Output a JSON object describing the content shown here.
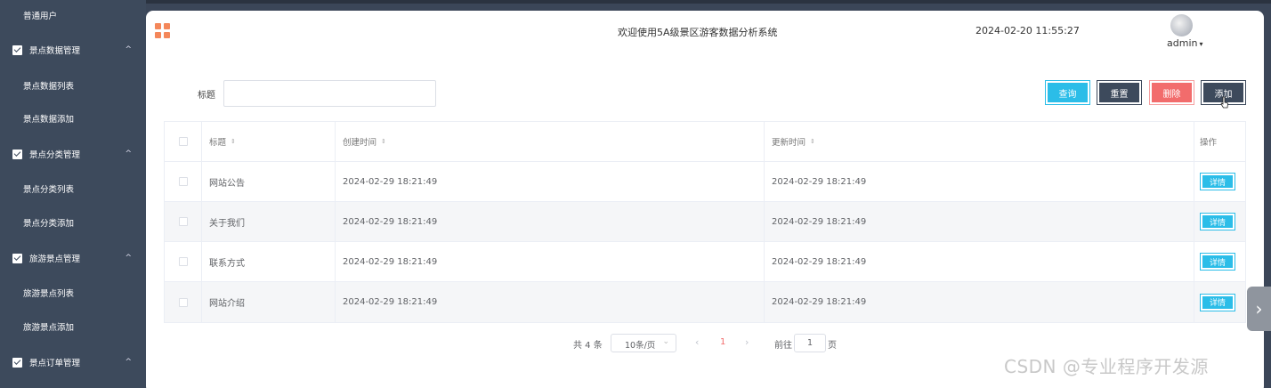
{
  "sidebar": {
    "items": [
      {
        "type": "sub",
        "label": "普通用户"
      },
      {
        "type": "group",
        "label": "景点数据管理",
        "chevron": "^"
      },
      {
        "type": "sub",
        "label": "景点数据列表"
      },
      {
        "type": "sub",
        "label": "景点数据添加"
      },
      {
        "type": "group",
        "label": "景点分类管理",
        "chevron": "^"
      },
      {
        "type": "sub",
        "label": "景点分类列表"
      },
      {
        "type": "sub",
        "label": "景点分类添加"
      },
      {
        "type": "group",
        "label": "旅游景点管理",
        "chevron": "^"
      },
      {
        "type": "sub",
        "label": "旅游景点列表"
      },
      {
        "type": "sub",
        "label": "旅游景点添加"
      },
      {
        "type": "group",
        "label": "景点订单管理",
        "chevron": "^"
      }
    ]
  },
  "header": {
    "welcome": "欢迎使用5A级景区游客数据分析系统",
    "datetime": "2024-02-20 11:55:27",
    "username": "admin",
    "caret": "▾"
  },
  "filter": {
    "label": "标题",
    "value": "",
    "placeholder": ""
  },
  "toolbar": {
    "query": "查询",
    "reset": "重置",
    "delete": "删除",
    "add": "添加"
  },
  "table": {
    "columns": {
      "title": "标题",
      "created": "创建时间",
      "updated": "更新时间",
      "ops": "操作",
      "sort_icon": "⇕"
    },
    "rows": [
      {
        "title": "网站公告",
        "created": "2024-02-29 18:21:49",
        "updated": "2024-02-29 18:21:49",
        "action": "详情"
      },
      {
        "title": "关于我们",
        "created": "2024-02-29 18:21:49",
        "updated": "2024-02-29 18:21:49",
        "action": "详情"
      },
      {
        "title": "联系方式",
        "created": "2024-02-29 18:21:49",
        "updated": "2024-02-29 18:21:49",
        "action": "详情"
      },
      {
        "title": "网站介绍",
        "created": "2024-02-29 18:21:49",
        "updated": "2024-02-29 18:21:49",
        "action": "详情"
      }
    ]
  },
  "pagination": {
    "total": "共 4 条",
    "page_size": "10条/页",
    "prev": "‹",
    "current": "1",
    "next": "›",
    "goto_label": "前往",
    "goto_value": "1",
    "page_suffix": "页"
  },
  "side_handle": "›",
  "watermark": "CSDN @专业程序开发源"
}
